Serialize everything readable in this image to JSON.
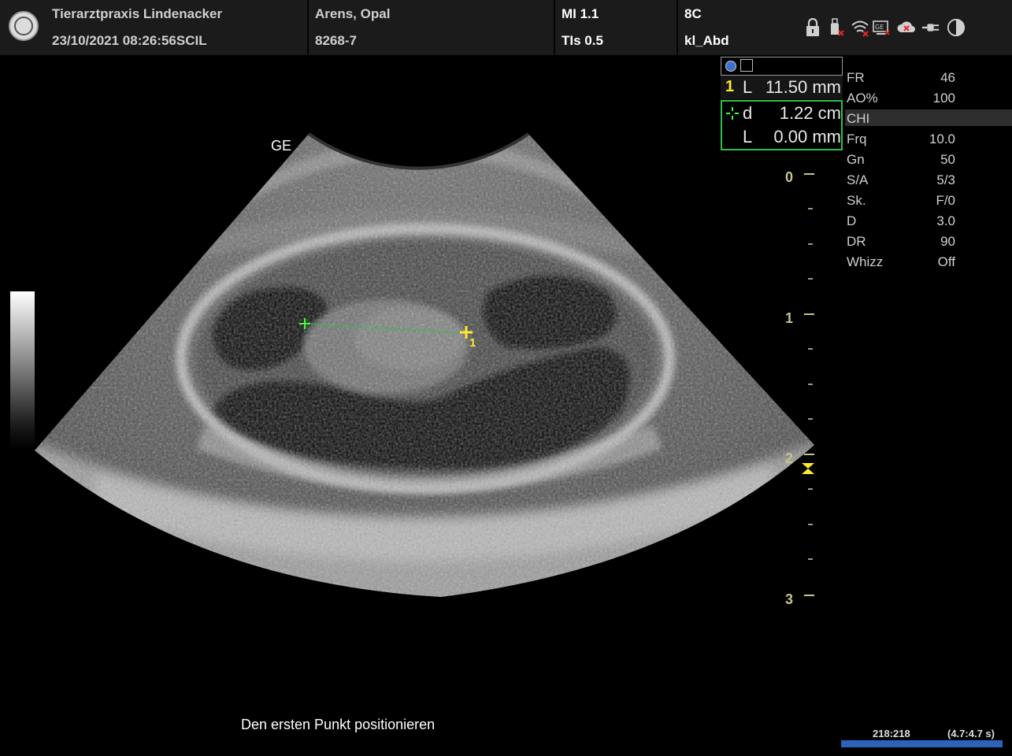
{
  "header": {
    "clinic": "Tierarztpraxis Lindenacker",
    "datetime": "23/10/2021 08:26:56SCIL",
    "patient_name": "Arens, Opal",
    "patient_id": "8268-7",
    "mi": "MI 1.1",
    "tis": "TIs 0.5",
    "probe": "8C",
    "preset": "kl_Abd"
  },
  "image": {
    "brand_label": "GE"
  },
  "measurement": {
    "m1_index": "1",
    "m1_label": "L",
    "m1_value": "11.50 mm",
    "m2_label_d": "d",
    "m2_value_d": "1.22 cm",
    "m2_label_l": "L",
    "m2_value_l": "0.00 mm"
  },
  "caliper": {
    "index_label": "1"
  },
  "parameters": [
    {
      "label": "FR",
      "value": "46"
    },
    {
      "label": "AO%",
      "value": "100"
    },
    {
      "label": "CHI",
      "value": ""
    },
    {
      "label": "Frq",
      "value": "10.0"
    },
    {
      "label": "Gn",
      "value": "50"
    },
    {
      "label": "S/A",
      "value": "5/3"
    },
    {
      "label": "Sk.",
      "value": "F/0"
    },
    {
      "label": "D",
      "value": "3.0"
    },
    {
      "label": "DR",
      "value": "90"
    },
    {
      "label": "Whizz",
      "value": "Off"
    }
  ],
  "depth_scale": {
    "labels": [
      "0",
      "1",
      "2",
      "3"
    ]
  },
  "status_message": "Den ersten Punkt positionieren",
  "cine": {
    "frames": "218:218",
    "time": "(4.7:4.7 s)"
  },
  "colors": {
    "measure_green": "#2fc04a",
    "caliper_yellow": "#ffe832",
    "scale_color": "#c7c38c",
    "cine_blue": "#2a63b8"
  },
  "status_icons": [
    "lock-icon",
    "usb-disconnected-icon",
    "wifi-off-icon",
    "network-icon",
    "cloud-off-icon",
    "power-plug-icon",
    "contrast-icon"
  ]
}
